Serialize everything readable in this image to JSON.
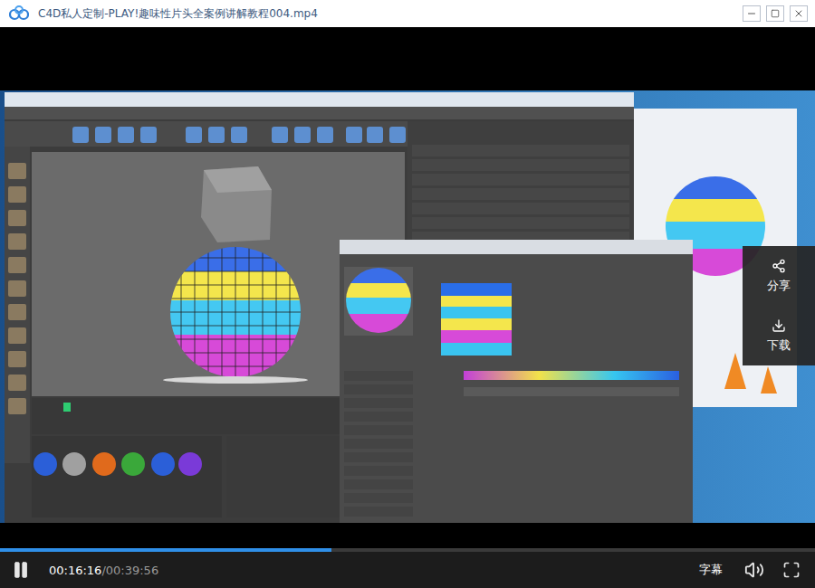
{
  "window": {
    "title": "C4D私人定制-PLAY!趣味性片头全案例讲解教程004.mp4"
  },
  "side_actions": [
    {
      "label": "分享",
      "kind": "share"
    },
    {
      "label": "下载",
      "kind": "download"
    }
  ],
  "player": {
    "playing": true,
    "current_time": "00:16:16",
    "total_time": "/00:39:56",
    "level": 0.407,
    "subtitle_button": "字幕"
  }
}
